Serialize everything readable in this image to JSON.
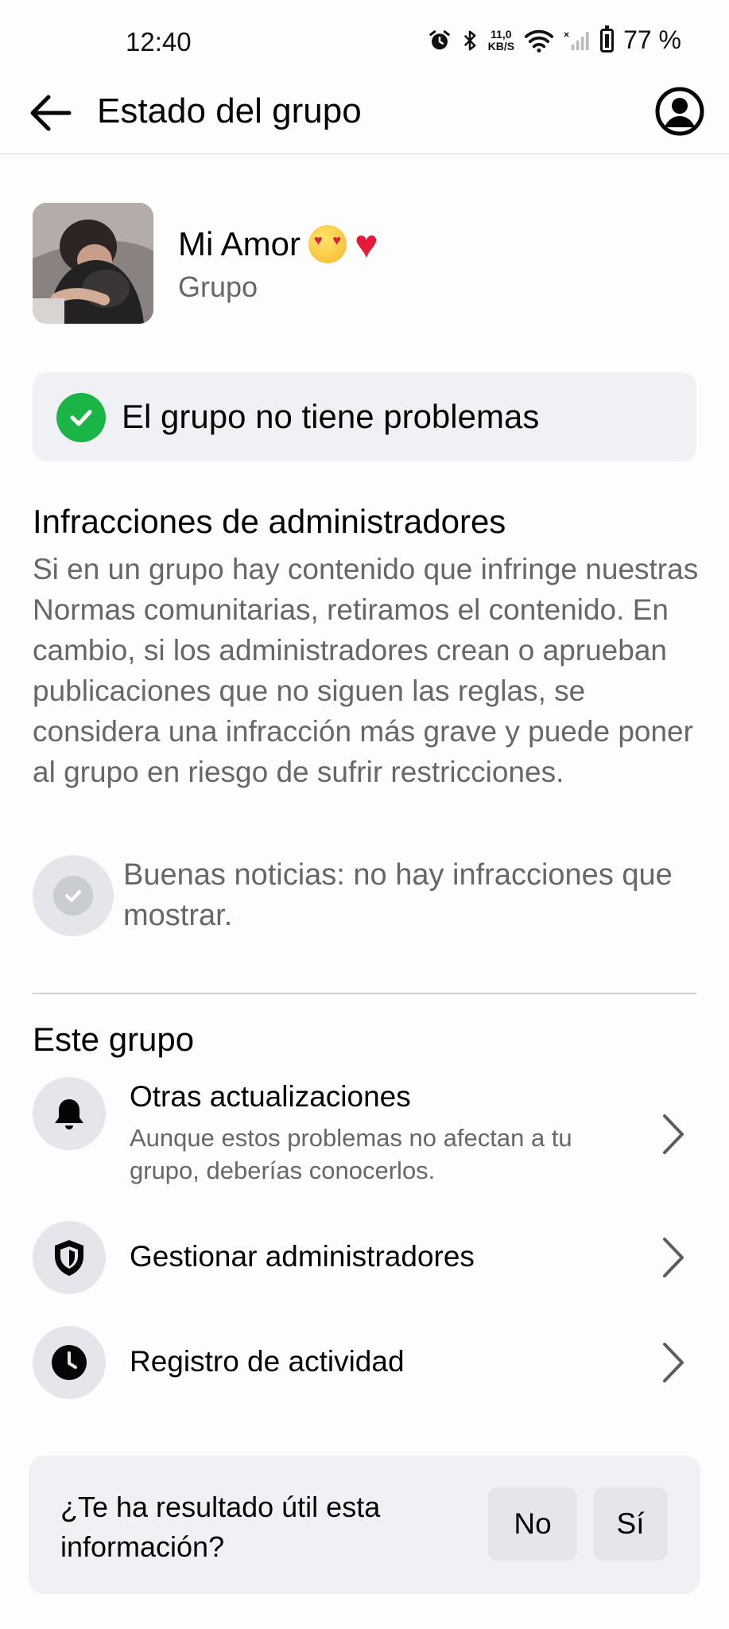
{
  "status_bar": {
    "time": "12:40",
    "net_speed_value": "11,0",
    "net_speed_unit": "KB/S",
    "battery": "77 %"
  },
  "header": {
    "title": "Estado del grupo"
  },
  "group": {
    "name": "Mi Amor",
    "type": "Grupo"
  },
  "status": {
    "text": "El grupo no tiene problemas",
    "color": "#1ab546"
  },
  "infractions": {
    "title": "Infracciones de administradores",
    "description": "Si en un grupo hay contenido que infringe nuestras Normas comunitarias, retiramos el contenido. En cambio, si los administradores crean o aprueban publicaciones que no siguen las reglas, se considera una infracción más grave y puede poner al grupo en riesgo de sufrir restricciones.",
    "good_news": "Buenas noticias: no hay infracciones que mostrar."
  },
  "this_group": {
    "title": "Este grupo",
    "items": [
      {
        "label": "Otras actualizaciones",
        "subtitle": "Aunque estos problemas no afectan a tu grupo, deberías conocerlos.",
        "icon": "bell-icon"
      },
      {
        "label": "Gestionar administradores",
        "subtitle": "",
        "icon": "shield-icon"
      },
      {
        "label": "Registro de actividad",
        "subtitle": "",
        "icon": "clock-icon"
      }
    ]
  },
  "feedback": {
    "question": "¿Te ha resultado útil esta información?",
    "no_label": "No",
    "yes_label": "Sí"
  }
}
